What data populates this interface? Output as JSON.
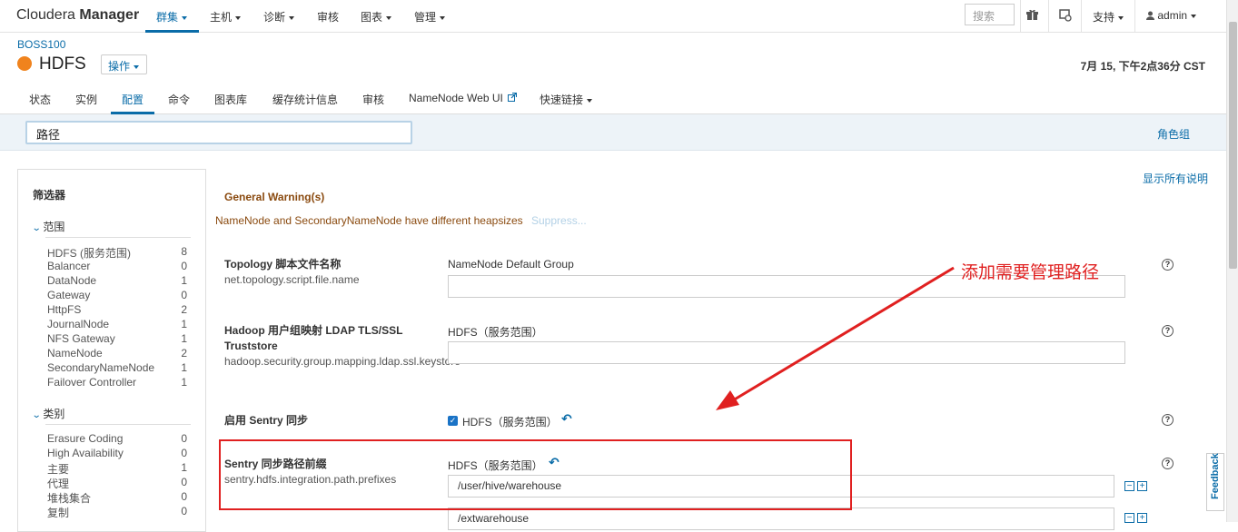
{
  "brand": {
    "light": "Cloudera ",
    "bold": "Manager"
  },
  "nav": {
    "items": [
      {
        "label": "群集",
        "caret": true
      },
      {
        "label": "主机",
        "caret": true
      },
      {
        "label": "诊断",
        "caret": true
      },
      {
        "label": "审核",
        "caret": false
      },
      {
        "label": "图表",
        "caret": true
      },
      {
        "label": "管理",
        "caret": true
      }
    ],
    "search_placeholder": "搜索",
    "support": "支持",
    "user": "admin"
  },
  "header": {
    "breadcrumb": "BOSS100",
    "service_name": "HDFS",
    "actions_label": "操作",
    "datetime": "7月 15, 下午2点36分 CST",
    "status_color": "#f0831d"
  },
  "tabs": [
    "状态",
    "实例",
    "配置",
    "命令",
    "图表库",
    "缓存统计信息",
    "审核",
    "NameNode Web UI",
    "快速链接"
  ],
  "config_search": {
    "value": "路径"
  },
  "role_groups": "角色组",
  "show_all_desc": "显示所有说明",
  "filter": {
    "title": "筛选器",
    "scope": {
      "title": "范围",
      "items": [
        {
          "label": "HDFS (服务范围)",
          "count": "8"
        },
        {
          "label": "Balancer",
          "count": "0"
        },
        {
          "label": "DataNode",
          "count": "1"
        },
        {
          "label": "Gateway",
          "count": "0"
        },
        {
          "label": "HttpFS",
          "count": "2"
        },
        {
          "label": "JournalNode",
          "count": "1"
        },
        {
          "label": "NFS Gateway",
          "count": "1"
        },
        {
          "label": "NameNode",
          "count": "2"
        },
        {
          "label": "SecondaryNameNode",
          "count": "1"
        },
        {
          "label": "Failover Controller",
          "count": "1"
        }
      ]
    },
    "category": {
      "title": "类别",
      "items": [
        {
          "label": "Erasure Coding",
          "count": "0"
        },
        {
          "label": "High Availability",
          "count": "0"
        },
        {
          "label": "主要",
          "count": "1"
        },
        {
          "label": "代理",
          "count": "0"
        },
        {
          "label": "堆栈集合",
          "count": "0"
        },
        {
          "label": "复制",
          "count": "0"
        }
      ]
    }
  },
  "warning": {
    "title": "General Warning(s)",
    "text": "NameNode and SecondaryNameNode have different heapsizes",
    "suppress": "Suppress..."
  },
  "params": [
    {
      "name": "Topology 脚本文件名称",
      "key": "net.topology.script.file.name",
      "scope": "NameNode Default Group",
      "value": ""
    },
    {
      "name": "Hadoop 用户组映射 LDAP TLS/SSL Truststore",
      "key": "hadoop.security.group.mapping.ldap.ssl.keystore",
      "scope": "HDFS（服务范围）",
      "value": ""
    },
    {
      "name": "启用 Sentry 同步",
      "key": "",
      "scope": "HDFS（服务范围）",
      "checked": true
    },
    {
      "name": "Sentry 同步路径前缀",
      "key": "sentry.hdfs.integration.path.prefixes",
      "scope": "HDFS（服务范围）",
      "values": [
        "/user/hive/warehouse",
        "/extwarehouse"
      ]
    }
  ],
  "annotation": "添加需要管理路径",
  "feedback": "Feedback",
  "colors": {
    "accent": "#0a6ca8",
    "annotation": "#e02020",
    "warning": "#8a4a0f"
  }
}
